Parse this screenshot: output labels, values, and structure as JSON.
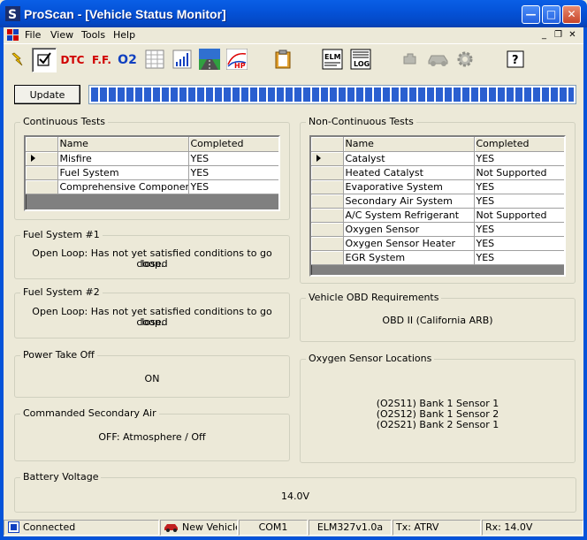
{
  "window": {
    "title": "ProScan - [Vehicle Status Monitor]"
  },
  "menu": [
    "File",
    "View",
    "Tools",
    "Help"
  ],
  "toolbar": {
    "dtc_label": "DTC",
    "ff_label": "F.F.",
    "o2_label": "O2",
    "elm_label": "ELM",
    "log_label": "LOG",
    "hp_label": "HP"
  },
  "update_button": {
    "label": "Update"
  },
  "progress": {
    "fraction": 1.0
  },
  "continuous_tests": {
    "title": "Continuous Tests",
    "columns": [
      "Name",
      "Completed"
    ],
    "rows": [
      {
        "name": "Misfire",
        "completed": "YES",
        "selected": true
      },
      {
        "name": "Fuel System",
        "completed": "YES",
        "selected": false
      },
      {
        "name": "Comprehensive Component",
        "completed": "YES",
        "selected": false
      }
    ]
  },
  "non_continuous_tests": {
    "title": "Non-Continuous Tests",
    "columns": [
      "Name",
      "Completed"
    ],
    "rows": [
      {
        "name": "Catalyst",
        "completed": "YES",
        "selected": true
      },
      {
        "name": "Heated Catalyst",
        "completed": "Not Supported",
        "selected": false
      },
      {
        "name": "Evaporative System",
        "completed": "YES",
        "selected": false
      },
      {
        "name": "Secondary Air System",
        "completed": "YES",
        "selected": false
      },
      {
        "name": "A/C System Refrigerant",
        "completed": "Not Supported",
        "selected": false
      },
      {
        "name": "Oxygen Sensor",
        "completed": "YES",
        "selected": false
      },
      {
        "name": "Oxygen Sensor Heater",
        "completed": "YES",
        "selected": false
      },
      {
        "name": "EGR System",
        "completed": "YES",
        "selected": false
      }
    ]
  },
  "fuel_system_1": {
    "title": "Fuel System #1",
    "line1": "Open Loop: Has not yet satisfied conditions to go closed",
    "line2": "loop."
  },
  "fuel_system_2": {
    "title": "Fuel System #2",
    "line1": "Open Loop: Has not yet satisfied conditions to go closed",
    "line2": "loop."
  },
  "power_take_off": {
    "title": "Power Take Off",
    "value": "ON"
  },
  "commanded_secondary_air": {
    "title": "Commanded Secondary Air",
    "value": "OFF: Atmosphere / Off"
  },
  "obd_requirements": {
    "title": "Vehicle OBD Requirements",
    "value": "OBD II (California ARB)"
  },
  "oxygen_sensor_locations": {
    "title": "Oxygen Sensor Locations",
    "lines": [
      "(O2S11) Bank 1 Sensor 1",
      "(O2S12) Bank 1 Sensor 2",
      "(O2S21) Bank 2 Sensor 1"
    ]
  },
  "battery_voltage": {
    "title": "Battery Voltage",
    "value": "14.0V"
  },
  "statusbar": {
    "connection": "Connected",
    "vehicle": "New Vehicle",
    "port": "COM1",
    "interface": "ELM327v1.0a",
    "tx": "Tx: ATRV",
    "rx": "Rx: 14.0V"
  },
  "icons": [
    "app-icon",
    "connect-icon",
    "status-icon",
    "dtc-icon",
    "freeze-frame-icon",
    "o2-icon",
    "table-icon",
    "graph-icon",
    "road-icon",
    "dyno-icon",
    "clipboard-icon",
    "elm-icon",
    "log-icon",
    "engine-icon",
    "car-icon",
    "gear-icon",
    "help-icon",
    "car-status-icon",
    "connected-icon"
  ],
  "colors": {
    "titlebar": "#0553D9",
    "progress": "#2A5FD0",
    "window_bg": "#ECE9D8",
    "dtc_red": "#D00000",
    "o2_blue": "#1040C0"
  }
}
